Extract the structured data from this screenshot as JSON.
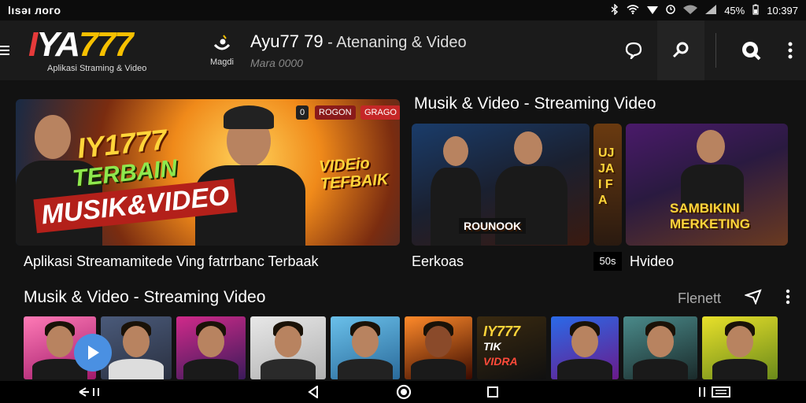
{
  "status": {
    "left": "lısəı лого",
    "battery": "45%",
    "time": "10:397"
  },
  "appbar": {
    "logo": {
      "part1": "I",
      "part2": "Y",
      "part3": "A",
      "part4": "777"
    },
    "logo_subtitle": "Aplikasi Straming & Video",
    "brand_icon_label": "Magdi",
    "title": "Ayu77 79",
    "title_suffix": " - Atenaning & Video",
    "subtitle": "Mara 0000"
  },
  "hero": {
    "badges": [
      "0",
      "ROGON",
      "GRAGO"
    ],
    "text1": "IY1777",
    "text2": "TERBAIN",
    "text3": "MUSIK&VIDEO",
    "text4_line1": "VIDEio",
    "text4_line2": "TEFBAIK",
    "caption": "Aplikasi Streamamitede Ving fatrrbanc Terbaak"
  },
  "section1": {
    "title": "Musik & Video - Streaming Video"
  },
  "cards": {
    "card1_text": "ROUNOOK",
    "card1_caption": "Eerkoas",
    "card_mid_text": "UJ JAI FA",
    "card2_text_line1": "SAMBIKINI",
    "card2_text_line2": "MERKETING",
    "small_badge": "50s",
    "card2_caption": "Hvideo"
  },
  "section2": {
    "title": "Musik & Video - Streaming Video",
    "filter_label": "Flenett"
  },
  "thumb_text": {
    "line1": "IY777",
    "line2": "TIK",
    "line3": "VIDRA"
  }
}
